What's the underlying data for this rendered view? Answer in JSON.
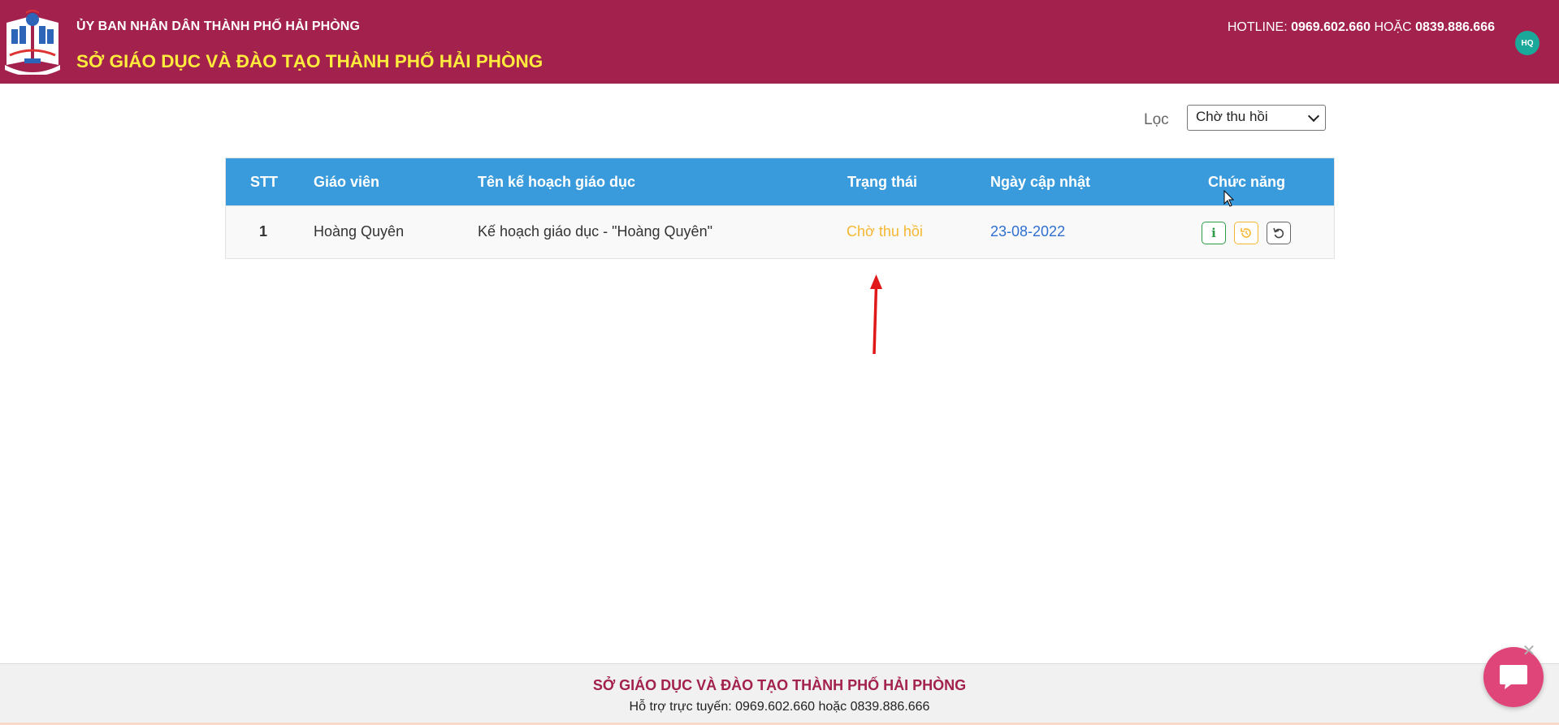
{
  "header": {
    "org_sub": "ỦY BAN NHÂN DÂN THÀNH PHỐ HẢI PHÒNG",
    "org_main": "SỞ GIÁO DỤC VÀ ĐÀO TẠO THÀNH PHỐ HẢI PHÒNG",
    "hotline_label": "HOTLINE:",
    "hotline_1": "0969.602.660",
    "hotline_or": "HOẶC",
    "hotline_2": "0839.886.666",
    "avatar_initials": "HQ"
  },
  "filter": {
    "label": "Lọc",
    "selected": "Chờ thu hồi"
  },
  "table": {
    "headers": [
      "STT",
      "Giáo viên",
      "Tên kế hoạch giáo dục",
      "Trạng thái",
      "Ngày cập nhật",
      "Chức năng"
    ],
    "rows": [
      {
        "stt": "1",
        "teacher": "Hoàng Quyên",
        "plan": "Kế hoạch giáo dục - \"Hoàng Quyên\"",
        "status": "Chờ thu hồi",
        "updated": "23-08-2022",
        "actions": [
          "info-icon",
          "recall-icon",
          "undo-icon"
        ]
      }
    ]
  },
  "footer": {
    "title": "SỞ GIÁO DỤC VÀ ĐÀO TẠO THÀNH PHỐ HẢI PHÒNG",
    "support": "Hỗ trợ trực tuyến: 0969.602.660 hoặc 0839.886.666"
  },
  "colors": {
    "header_bg": "#a2214d",
    "header_title": "#ffeb3b",
    "table_head_bg": "#3a9bdc",
    "status_pending": "#f5b731",
    "date": "#2f6fd0",
    "chat": "#e0457a"
  }
}
